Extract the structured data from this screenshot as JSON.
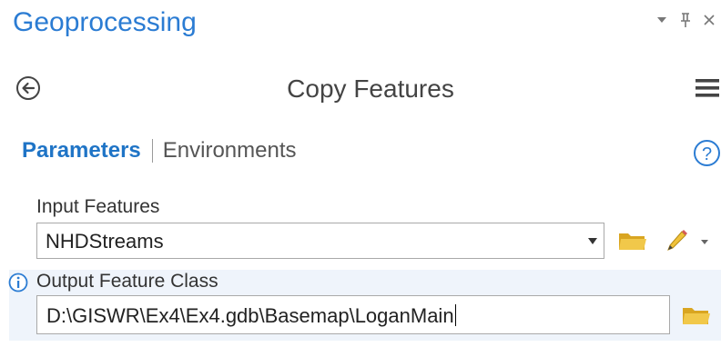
{
  "pane": {
    "title": "Geoprocessing",
    "controls": [
      "options-dropdown-icon",
      "pin-icon",
      "close-icon"
    ]
  },
  "tool": {
    "title": "Copy Features",
    "back_icon": "back-arrow-icon",
    "menu_icon": "hamburger-menu-icon"
  },
  "tabs": {
    "active": "Parameters",
    "items": [
      "Parameters",
      "Environments"
    ],
    "help_icon": "help-icon"
  },
  "parameters": {
    "input_features": {
      "label": "Input Features",
      "value": "NHDStreams",
      "browse_icon": "folder-icon",
      "edit_icon": "pencil-icon"
    },
    "output_feature_class": {
      "label": "Output Feature Class",
      "value": "D:\\GISWR\\Ex4\\Ex4.gdb\\Basemap\\LoganMain",
      "info_icon": "info-icon",
      "browse_icon": "folder-icon"
    }
  },
  "colors": {
    "accent": "#2b7cd3",
    "active_tab": "#1f74c6",
    "highlight_row": "#eff4fb",
    "folder": "#e9b92d"
  }
}
